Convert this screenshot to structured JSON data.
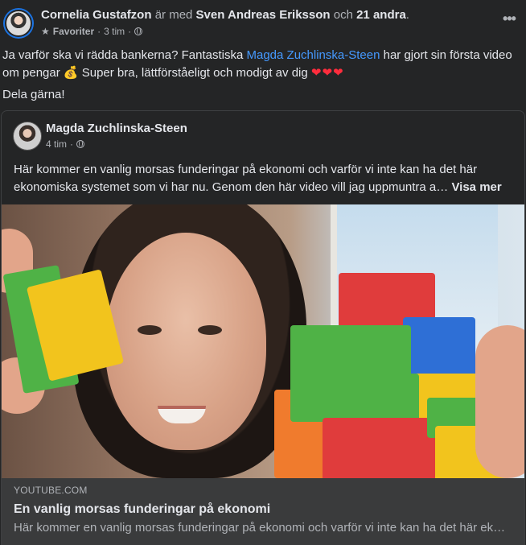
{
  "post": {
    "author": "Cornelia Gustafzon",
    "with_text": "är med",
    "tagged": "Sven Andreas Eriksson",
    "and_text": "och",
    "others": "21 andra",
    "period": ".",
    "audience_label": "Favoriter",
    "time": "3 tim",
    "dot": "·",
    "text_line1_a": "Ja varför ska vi rädda bankerna? Fantastiska ",
    "mention": "Magda Zuchlinska-Steen",
    "text_line1_b": " har gjort sin första video om pengar 💰 Super bra, lättförståeligt och modigt av dig ",
    "hearts": "❤❤❤",
    "text_line2": "Dela gärna!"
  },
  "shared": {
    "author": "Magda Zuchlinska-Steen",
    "time": "4 tim",
    "dot": "·",
    "text": "Här kommer en vanlig morsas funderingar på ekonomi och varför vi inte kan ha det här ekonomiska systemet som vi har nu. Genom den här video vill jag uppmuntra a…",
    "see_more": "Visa mer"
  },
  "link": {
    "domain": "YOUTUBE.COM",
    "title": "En vanlig morsas funderingar på ekonomi",
    "description": "Här kommer en vanlig morsas funderingar på ekonomi och varför vi inte kan ha det här ek…"
  },
  "icons": {
    "more": "more-options-icon",
    "star": "star-icon",
    "globe": "globe-icon"
  },
  "colors": {
    "background": "#242526",
    "link_bar": "#3a3b3c",
    "mention": "#4599ff"
  }
}
